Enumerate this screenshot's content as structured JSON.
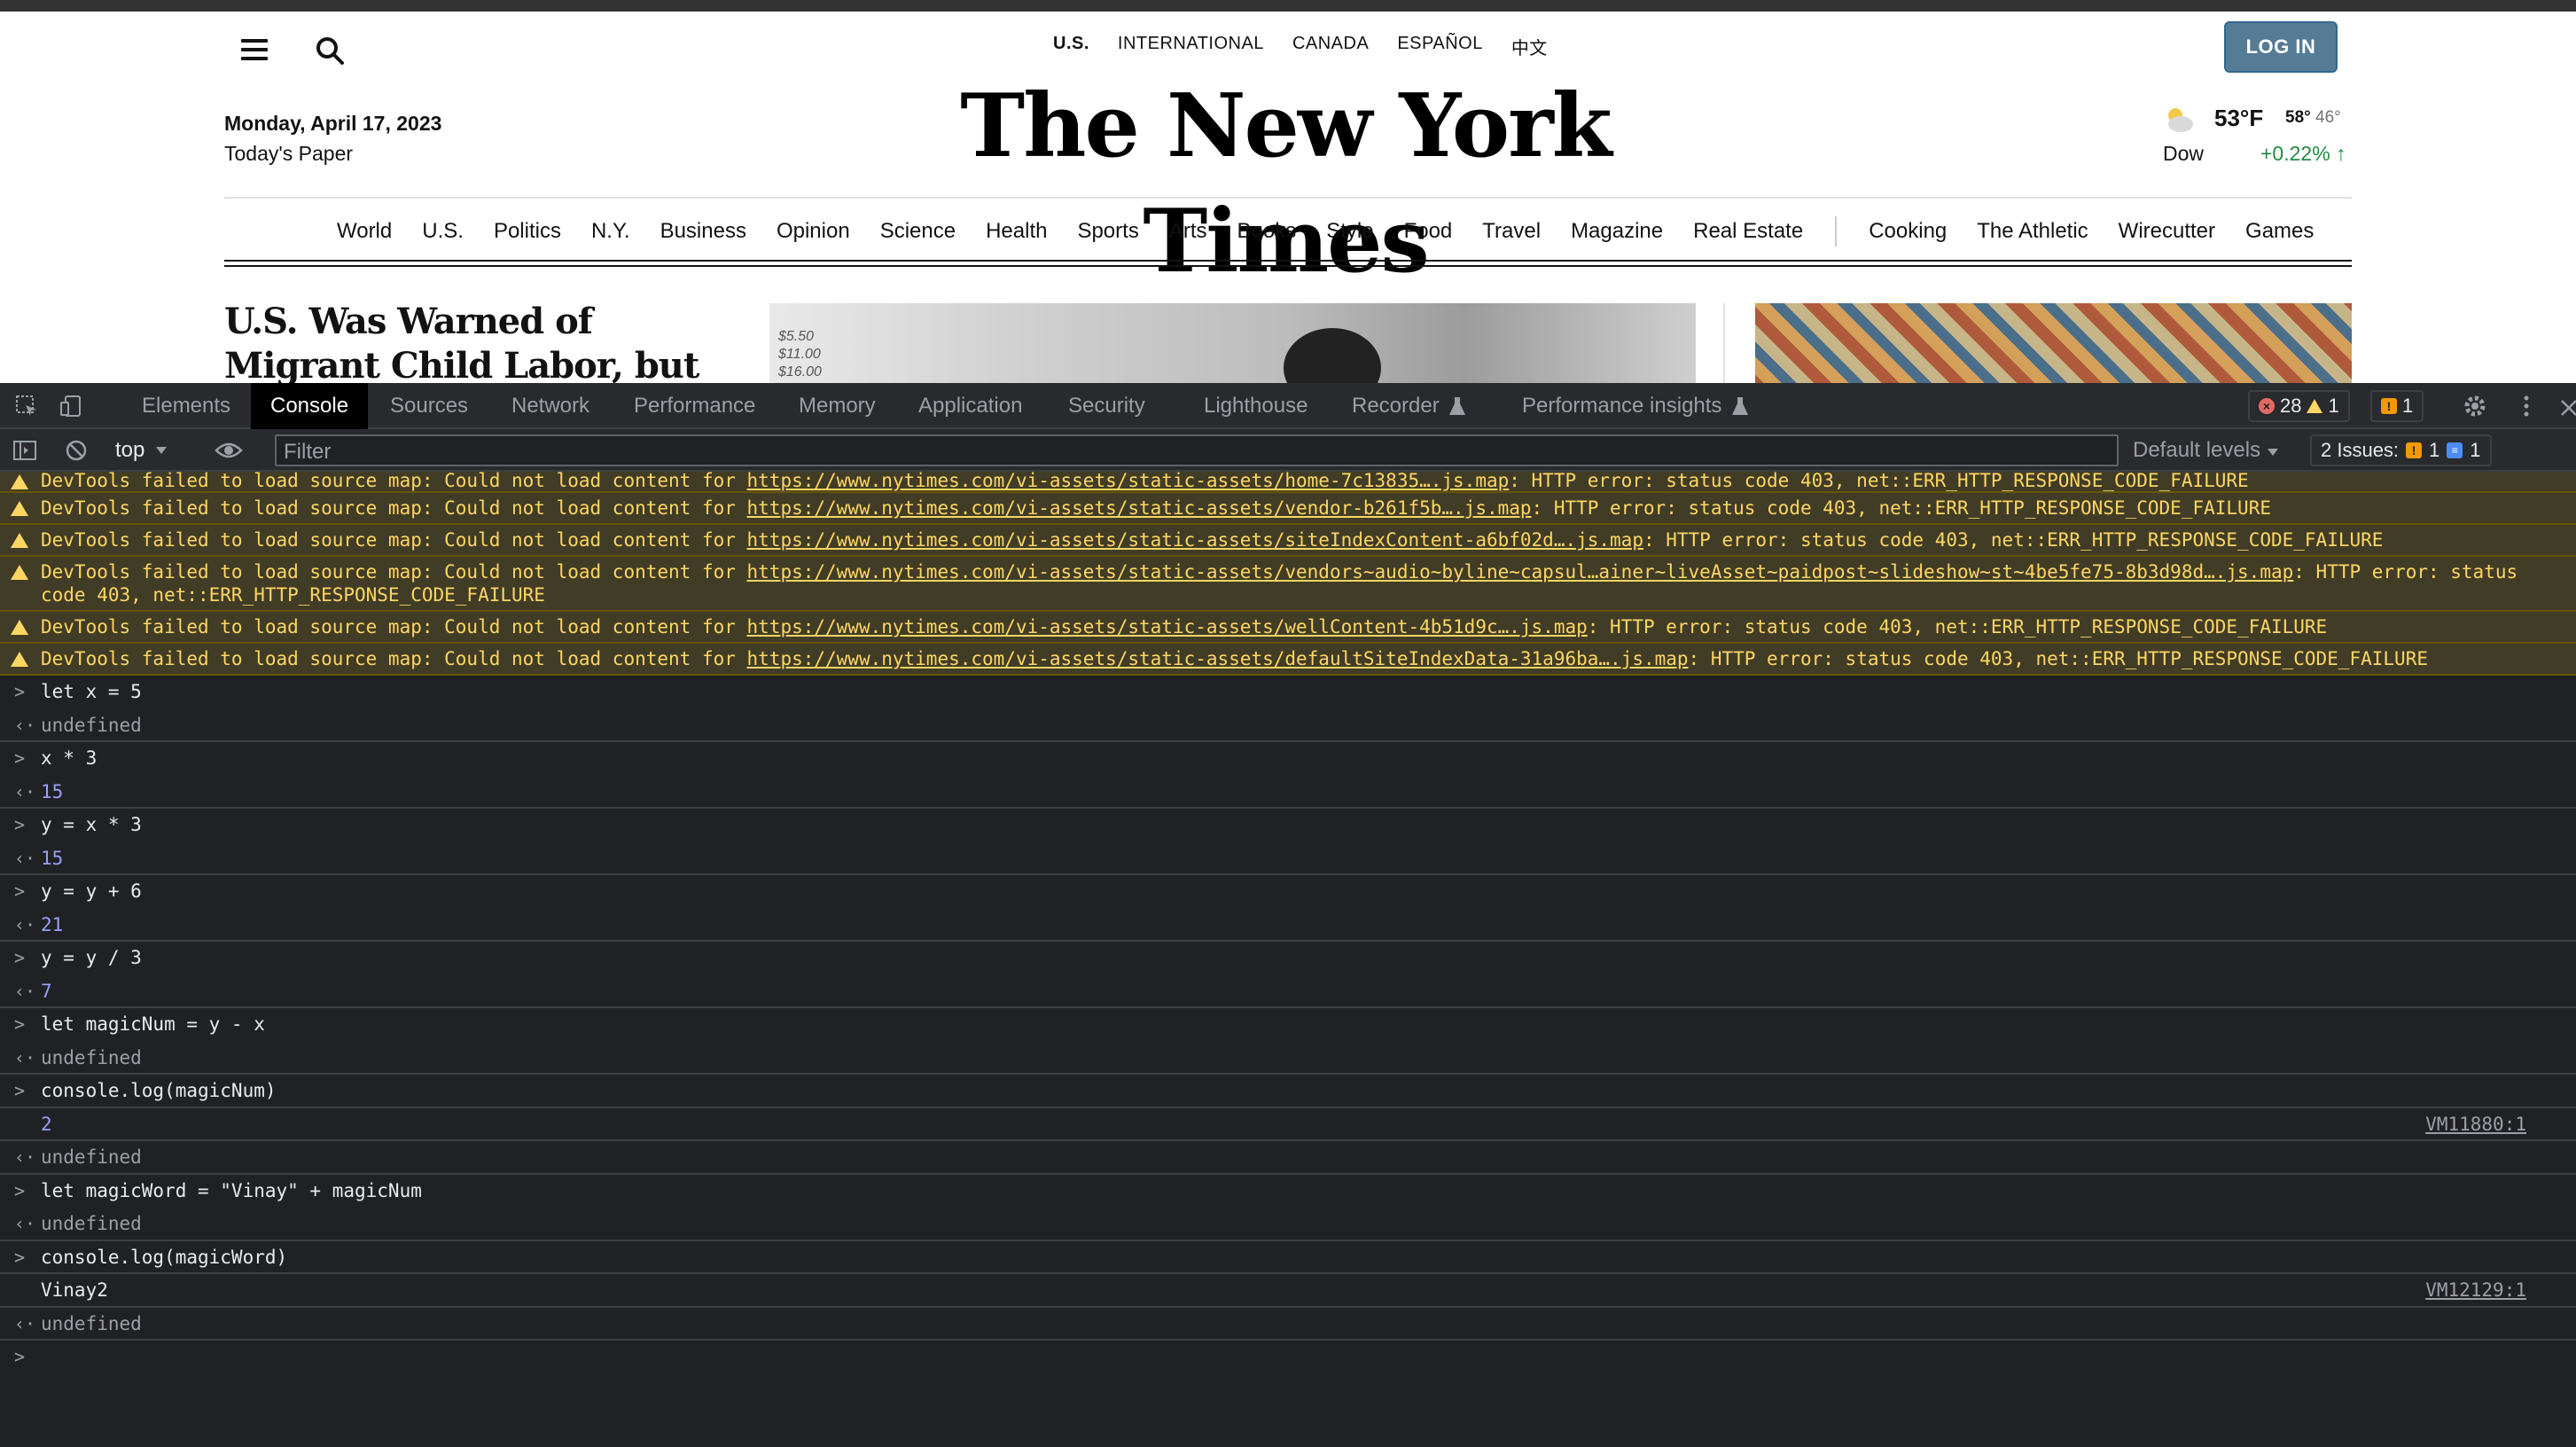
{
  "site": {
    "editions": [
      "U.S.",
      "INTERNATIONAL",
      "CANADA",
      "ESPAÑOL",
      "中文"
    ],
    "login_label": "LOG IN",
    "date": "Monday, April 17, 2023",
    "todays_paper": "Today's Paper",
    "logo": "The New York Times",
    "weather": {
      "temp": "53°F",
      "high": "58°",
      "low": "46°",
      "dow_label": "Dow",
      "dow_change": "+0.22% ↑"
    },
    "nav": [
      "World",
      "U.S.",
      "Politics",
      "N.Y.",
      "Business",
      "Opinion",
      "Science",
      "Health",
      "Sports",
      "Arts",
      "Books",
      "Style",
      "Food",
      "Travel",
      "Magazine",
      "Real Estate"
    ],
    "nav_secondary": [
      "Cooking",
      "The Athletic",
      "Wirecutter",
      "Games"
    ],
    "headline": "U.S. Was Warned of Migrant Child Labor, but ‘Didn’t Want"
  },
  "devtools": {
    "tabs": [
      "Elements",
      "Console",
      "Sources",
      "Network",
      "Performance",
      "Memory",
      "Application",
      "Security",
      "Lighthouse",
      "Recorder",
      "Performance insights"
    ],
    "active_tab": "Console",
    "error_count": "28",
    "warning_count": "1",
    "issue_count": "1",
    "context": "top",
    "filter_placeholder": "Filter",
    "levels": "Default levels",
    "issues_label": "2 Issues:",
    "issues_warn": "1",
    "issues_info": "1"
  },
  "console": {
    "warnings": [
      {
        "prefix": "DevTools failed to load source map: Could not load content for ",
        "url": "https://www.nytimes.com/vi-assets/static-assets/home-7c13835….js.map",
        "suffix": ": HTTP error: status code 403, net::ERR_HTTP_RESPONSE_CODE_FAILURE"
      },
      {
        "prefix": "DevTools failed to load source map: Could not load content for ",
        "url": "https://www.nytimes.com/vi-assets/static-assets/vendor-b261f5b….js.map",
        "suffix": ": HTTP error: status code 403, net::ERR_HTTP_RESPONSE_CODE_FAILURE"
      },
      {
        "prefix": "DevTools failed to load source map: Could not load content for ",
        "url": "https://www.nytimes.com/vi-assets/static-assets/siteIndexContent-a6bf02d….js.map",
        "suffix": ": HTTP error: status code 403, net::ERR_HTTP_RESPONSE_CODE_FAILURE"
      },
      {
        "prefix": "DevTools failed to load source map: Could not load content for ",
        "url": "https://www.nytimes.com/vi-assets/static-assets/vendors~audio~byline~capsul…ainer~liveAsset~paidpost~slideshow~st~4be5fe75-8b3d98d….js.map",
        "suffix": ": HTTP error: status code 403, net::ERR_HTTP_RESPONSE_CODE_FAILURE"
      },
      {
        "prefix": "DevTools failed to load source map: Could not load content for ",
        "url": "https://www.nytimes.com/vi-assets/static-assets/wellContent-4b51d9c….js.map",
        "suffix": ": HTTP error: status code 403, net::ERR_HTTP_RESPONSE_CODE_FAILURE"
      },
      {
        "prefix": "DevTools failed to load source map: Could not load content for ",
        "url": "https://www.nytimes.com/vi-assets/static-assets/defaultSiteIndexData-31a96ba….js.map",
        "suffix": ": HTTP error: status code 403, net::ERR_HTTP_RESPONSE_CODE_FAILURE"
      }
    ],
    "in1": "let x = 5",
    "out1": "undefined",
    "in2": "x * 3",
    "out2": "15",
    "in3": "y = x * 3",
    "out3": "15",
    "in4": "y = y + 6",
    "out4": "21",
    "in5": "y = y / 3",
    "out5": "7",
    "in6": "let magicNum = y - x",
    "out6": "undefined",
    "in7": "console.log(magicNum)",
    "log7": "2",
    "src7": "VM11880:1",
    "out7": "undefined",
    "in8": "let magicWord = \"Vinay\" + magicNum",
    "out8": "undefined",
    "in9": "console.log(magicWord)",
    "log9": "Vinay2",
    "src9": "VM12129:1",
    "out9": "undefined"
  }
}
